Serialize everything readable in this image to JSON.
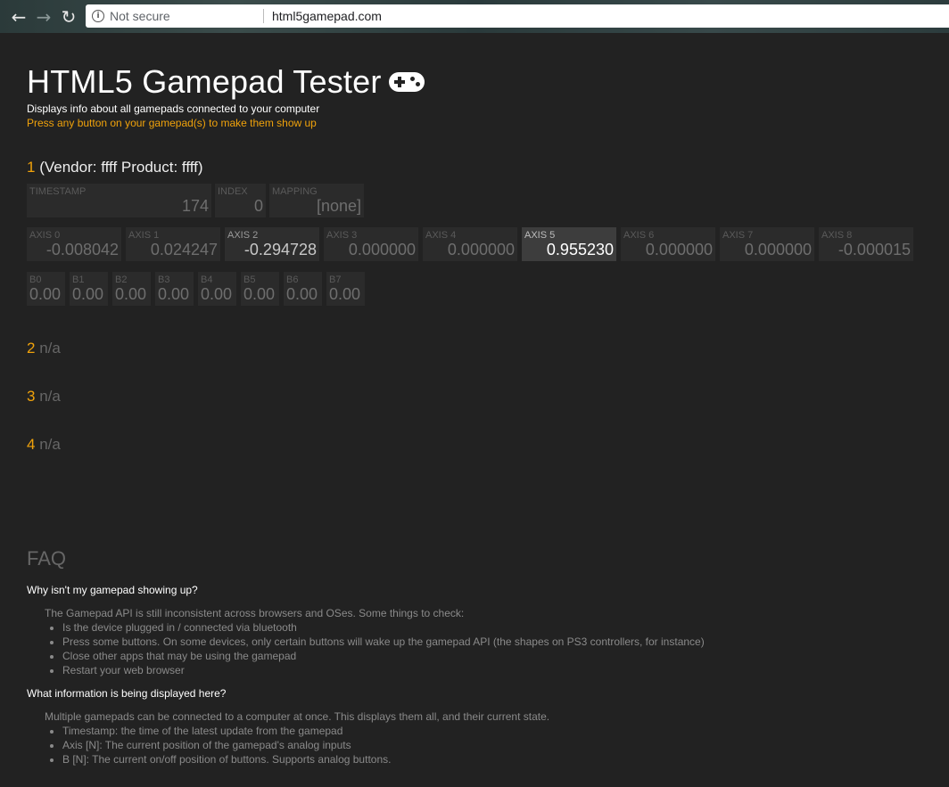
{
  "browser": {
    "back_icon": "arrow-left-icon",
    "forward_icon": "arrow-right-icon",
    "reload_icon": "reload-icon",
    "security_label": "Not secure",
    "url": "html5gamepad.com"
  },
  "header": {
    "title": "HTML5 Gamepad Tester",
    "subtitle": "Displays info about all gamepads connected to your computer",
    "hint": "Press any button on your gamepad(s) to make them show up"
  },
  "gamepad1": {
    "number": "1",
    "name": "(Vendor: ffff Product: ffff)",
    "timestamp_label": "TIMESTAMP",
    "timestamp": "174",
    "index_label": "INDEX",
    "index": "0",
    "mapping_label": "MAPPING",
    "mapping": "[none]",
    "axes": [
      {
        "label": "AXIS 0",
        "value": "-0.008042"
      },
      {
        "label": "AXIS 1",
        "value": "0.024247"
      },
      {
        "label": "AXIS 2",
        "value": "-0.294728"
      },
      {
        "label": "AXIS 3",
        "value": "0.000000"
      },
      {
        "label": "AXIS 4",
        "value": "0.000000"
      },
      {
        "label": "AXIS 5",
        "value": "0.955230"
      },
      {
        "label": "AXIS 6",
        "value": "0.000000"
      },
      {
        "label": "AXIS 7",
        "value": "0.000000"
      },
      {
        "label": "AXIS 8",
        "value": "-0.000015"
      }
    ],
    "buttons": [
      {
        "label": "B0",
        "value": "0.00"
      },
      {
        "label": "B1",
        "value": "0.00"
      },
      {
        "label": "B2",
        "value": "0.00"
      },
      {
        "label": "B3",
        "value": "0.00"
      },
      {
        "label": "B4",
        "value": "0.00"
      },
      {
        "label": "B5",
        "value": "0.00"
      },
      {
        "label": "B6",
        "value": "0.00"
      },
      {
        "label": "B7",
        "value": "0.00"
      }
    ]
  },
  "empty_slots": [
    {
      "number": "2",
      "status": "n/a"
    },
    {
      "number": "3",
      "status": "n/a"
    },
    {
      "number": "4",
      "status": "n/a"
    }
  ],
  "faq": {
    "title": "FAQ",
    "q1": "Why isn't my gamepad showing up?",
    "a1_intro": "The Gamepad API is still inconsistent across browsers and OSes. Some things to check:",
    "a1_items": [
      "Is the device plugged in / connected via bluetooth",
      "Press some buttons. On some devices, only certain buttons will wake up the gamepad API (the shapes on PS3 controllers, for instance)",
      "Close other apps that may be using the gamepad",
      "Restart your web browser"
    ],
    "q2": "What information is being displayed here?",
    "a2_intro": "Multiple gamepads can be connected to a computer at once. This displays them all, and their current state.",
    "a2_items": [
      "Timestamp: the time of the latest update from the gamepad",
      "Axis [N]: The current position of the gamepad's analog inputs",
      "B [N]: The current on/off position of buttons. Supports analog buttons."
    ]
  },
  "colors": {
    "background": "#222222",
    "accent": "#f0a20b",
    "box": "#2b2b2b",
    "box_active": "#3d3d3d"
  }
}
